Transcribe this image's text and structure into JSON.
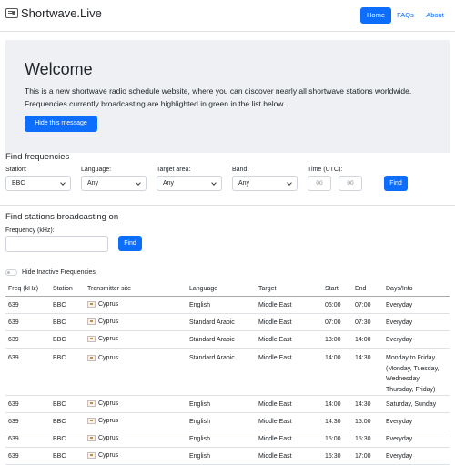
{
  "nav": {
    "brand": "Shortwave.Live",
    "links": [
      {
        "label": "Home",
        "active": true
      },
      {
        "label": "FAQs",
        "active": false
      },
      {
        "label": "About",
        "active": false
      }
    ]
  },
  "welcome": {
    "title": "Welcome",
    "text": "This is a new shortwave radio schedule website, where you can discover nearly all shortwave stations worldwide. Frequencies currently broadcasting are highlighted in green in the list below.",
    "hide_button": "Hide this message"
  },
  "find_frequencies": {
    "heading": "Find frequencies",
    "station_label": "Station:",
    "station_value": "BBC",
    "language_label": "Language:",
    "language_value": "Any",
    "target_label": "Target area:",
    "target_value": "Any",
    "band_label": "Band:",
    "band_value": "Any",
    "time_label": "Time (UTC):",
    "time_from_placeholder": "00",
    "time_to_placeholder": "00",
    "find_button": "Find"
  },
  "find_stations": {
    "heading": "Find stations broadcasting on",
    "frequency_label": "Frequency (kHz):",
    "frequency_value": "",
    "find_button": "Find"
  },
  "toggle": {
    "label": "Hide Inactive Frequencies",
    "checked": false
  },
  "table": {
    "headers": [
      "Freq (kHz)",
      "Station",
      "Transmitter site",
      "Language",
      "Target",
      "Start",
      "End",
      "Days/Info"
    ],
    "rows": [
      {
        "freq": "639",
        "station": "BBC",
        "site": "Cyprus",
        "language": "English",
        "target": "Middle East",
        "start": "06:00",
        "end": "07:00",
        "days": "Everyday"
      },
      {
        "freq": "639",
        "station": "BBC",
        "site": "Cyprus",
        "language": "Standard Arabic",
        "target": "Middle East",
        "start": "07:00",
        "end": "07:30",
        "days": "Everyday"
      },
      {
        "freq": "639",
        "station": "BBC",
        "site": "Cyprus",
        "language": "Standard Arabic",
        "target": "Middle East",
        "start": "13:00",
        "end": "14:00",
        "days": "Everyday"
      },
      {
        "freq": "639",
        "station": "BBC",
        "site": "Cyprus",
        "language": "Standard Arabic",
        "target": "Middle East",
        "start": "14:00",
        "end": "14:30",
        "days": "Monday to Friday (Monday, Tuesday, Wednesday, Thursday, Friday)"
      },
      {
        "freq": "639",
        "station": "BBC",
        "site": "Cyprus",
        "language": "English",
        "target": "Middle East",
        "start": "14:00",
        "end": "14:30",
        "days": "Saturday, Sunday"
      },
      {
        "freq": "639",
        "station": "BBC",
        "site": "Cyprus",
        "language": "English",
        "target": "Middle East",
        "start": "14:30",
        "end": "15:00",
        "days": "Everyday"
      },
      {
        "freq": "639",
        "station": "BBC",
        "site": "Cyprus",
        "language": "English",
        "target": "Middle East",
        "start": "15:00",
        "end": "15:30",
        "days": "Everyday"
      },
      {
        "freq": "639",
        "station": "BBC",
        "site": "Cyprus",
        "language": "English",
        "target": "Middle East",
        "start": "15:30",
        "end": "17:00",
        "days": "Everyday"
      }
    ]
  },
  "colors": {
    "accent": "#0d6efd",
    "welcome_bg": "#eef0f3",
    "border": "#dee2e6"
  }
}
